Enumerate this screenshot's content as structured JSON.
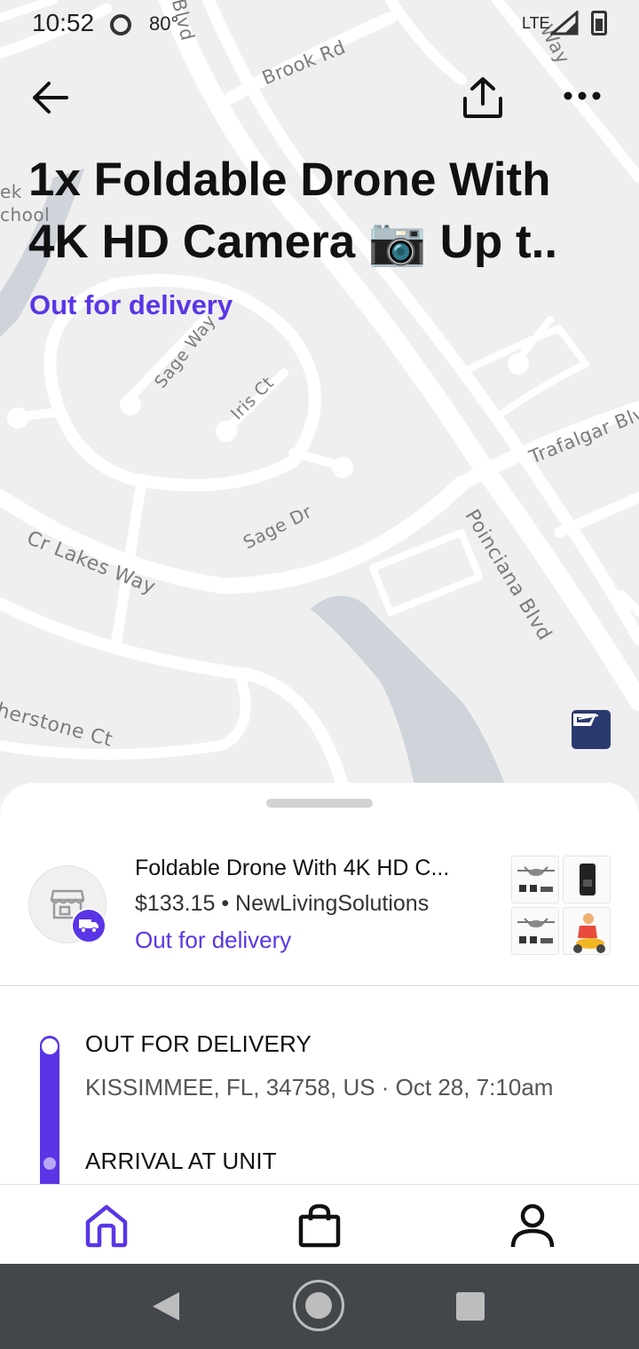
{
  "status_bar": {
    "time": "10:52",
    "temperature": "80°",
    "network": "LTE"
  },
  "map": {
    "labels": {
      "brook_rd": "Brook Rd",
      "blvd_top": "Blvd",
      "way_top": "Way",
      "ek": "ek",
      "school": "chool",
      "sage_way": "Sage Way",
      "iris_ct": "Iris Ct",
      "trafalgar": "Trafalgar Blvd",
      "sage_dr": "Sage Dr",
      "lakes_way": "Cr Lakes Way",
      "poinciana": "Poinciana Blvd",
      "herstone": "herstone Ct"
    },
    "carrier_icon": "usps-icon"
  },
  "header": {
    "back_icon": "arrow-left-icon",
    "share_icon": "share-icon",
    "more_icon": "more-horizontal-icon",
    "title": "1x Foldable Drone With 4K HD Camera 📷  Up t..",
    "status": "Out for delivery"
  },
  "order": {
    "name": "Foldable Drone With 4K HD C...",
    "meta": "$133.15 • NewLivingSolutions",
    "status": "Out for delivery",
    "store_icon": "store-icon",
    "badge_icon": "delivery-truck-icon"
  },
  "timeline": {
    "events": [
      {
        "title": "OUT FOR DELIVERY",
        "detail": "KISSIMMEE, FL, 34758, US · Oct 28, 7:10am"
      },
      {
        "title": "ARRIVAL AT UNIT"
      }
    ]
  },
  "bottom_nav": {
    "items": [
      {
        "icon": "home-icon",
        "active": true
      },
      {
        "icon": "shopping-bag-icon",
        "active": false
      },
      {
        "icon": "profile-icon",
        "active": false
      }
    ]
  },
  "colors": {
    "accent": "#5a35e6",
    "map_background": "#efeff0",
    "roads": "#ffffff",
    "water": "#cfd3da",
    "system_nav": "#43474b"
  }
}
